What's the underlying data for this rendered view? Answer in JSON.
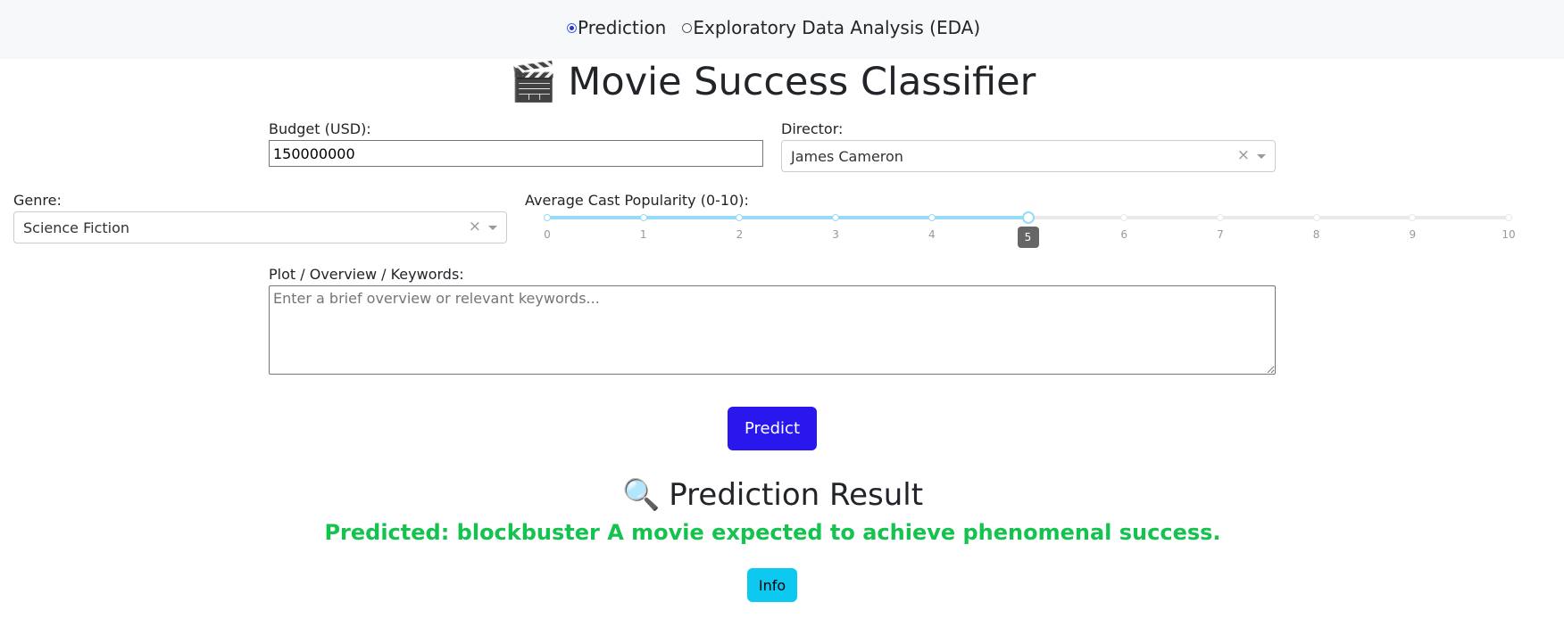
{
  "nav": {
    "options": [
      {
        "label": "Prediction",
        "checked": true
      },
      {
        "label": "Exploratory Data Analysis (EDA)",
        "checked": false
      }
    ]
  },
  "page": {
    "title_icon": "🎬",
    "title": "Movie Success Classifier"
  },
  "form": {
    "budget": {
      "label": "Budget (USD):",
      "value": "150000000"
    },
    "director": {
      "label": "Director:",
      "value": "James Cameron",
      "clear": "×"
    },
    "genre": {
      "label": "Genre:",
      "value": "Science Fiction",
      "clear": "×"
    },
    "popularity": {
      "label": "Average Cast Popularity (0-10):",
      "min": 0,
      "max": 10,
      "value": 5,
      "marks": [
        "0",
        "1",
        "2",
        "3",
        "4",
        "5",
        "6",
        "7",
        "8",
        "9",
        "10"
      ],
      "tooltip": "5"
    },
    "plot": {
      "label": "Plot / Overview / Keywords:",
      "placeholder": "Enter a brief overview or relevant keywords..."
    },
    "predict_label": "Predict"
  },
  "result": {
    "title_icon": "🔍",
    "title": "Prediction Result",
    "text": "Predicted: blockbuster A movie expected to achieve phenomenal success.",
    "info_label": "Info"
  },
  "colors": {
    "predict_button": "#2a17ee",
    "info_button": "#0dc8f0",
    "result_text": "#14c24e",
    "slider_track": "#96dbfa"
  }
}
